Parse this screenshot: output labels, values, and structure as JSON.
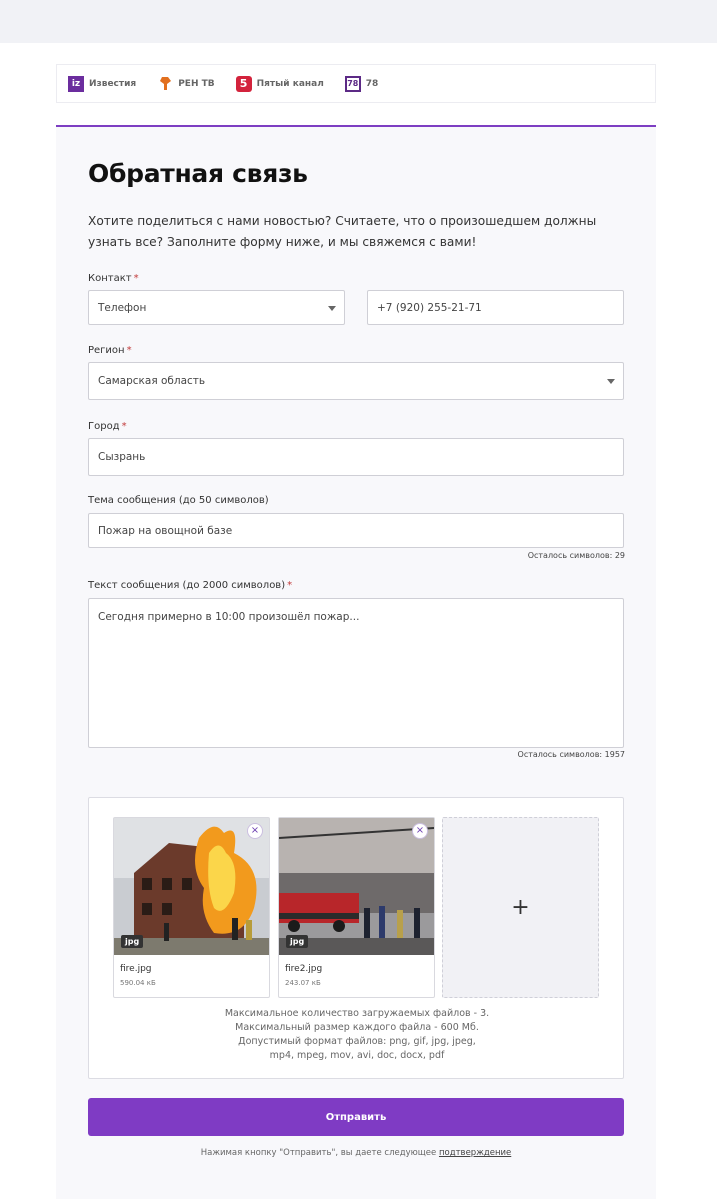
{
  "brands": [
    {
      "logo": "iz",
      "name": "Известия"
    },
    {
      "logo": "",
      "name": "РЕН ТВ"
    },
    {
      "logo": "5",
      "name": "Пятый канал"
    },
    {
      "logo": "78",
      "name": "78"
    }
  ],
  "form": {
    "title": "Обратная связь",
    "intro": "Хотите поделиться с нами новостью? Считаете, что о произошедшем должны узнать все? Заполните форму ниже, и мы свяжемся с вами!",
    "contact_label": "Контакт",
    "contact_type": "Телефон",
    "phone": "+7 (920) 255-21-71",
    "region_label": "Регион",
    "region": "Самарская область",
    "city_label": "Город",
    "city": "Сызрань",
    "subject_label": "Тема сообщения (до 50 символов)",
    "subject": "Пожар на овощной базе",
    "subject_counter": "Осталось символов: 29",
    "message_label": "Текст сообщения (до 2000 символов)",
    "message": "Сегодня примерно в 10:00 произошёл пожар...",
    "message_counter": "Осталось символов: 1957",
    "required_mark": "*"
  },
  "upload": {
    "files": [
      {
        "name": "fire.jpg",
        "size": "590.04 кБ",
        "ext": "jpg"
      },
      {
        "name": "fire2.jpg",
        "size": "243.07 кБ",
        "ext": "jpg"
      }
    ],
    "add_symbol": "+",
    "close_symbol": "×",
    "info": [
      "Максимальное количество загружаемых файлов - 3.",
      "Максимальный размер каждого файла - 600 Мб.",
      "Допустимый формат файлов: png, gif, jpg, jpeg,",
      "mp4, mpeg, mov, avi, doc, docx, pdf"
    ]
  },
  "submit_label": "Отправить",
  "consent_text": "Нажимая кнопку \"Отправить\", вы даете следующее",
  "consent_link": "подтверждение",
  "colors": {
    "accent": "#7f3bc4",
    "required": "#c23a3a"
  }
}
